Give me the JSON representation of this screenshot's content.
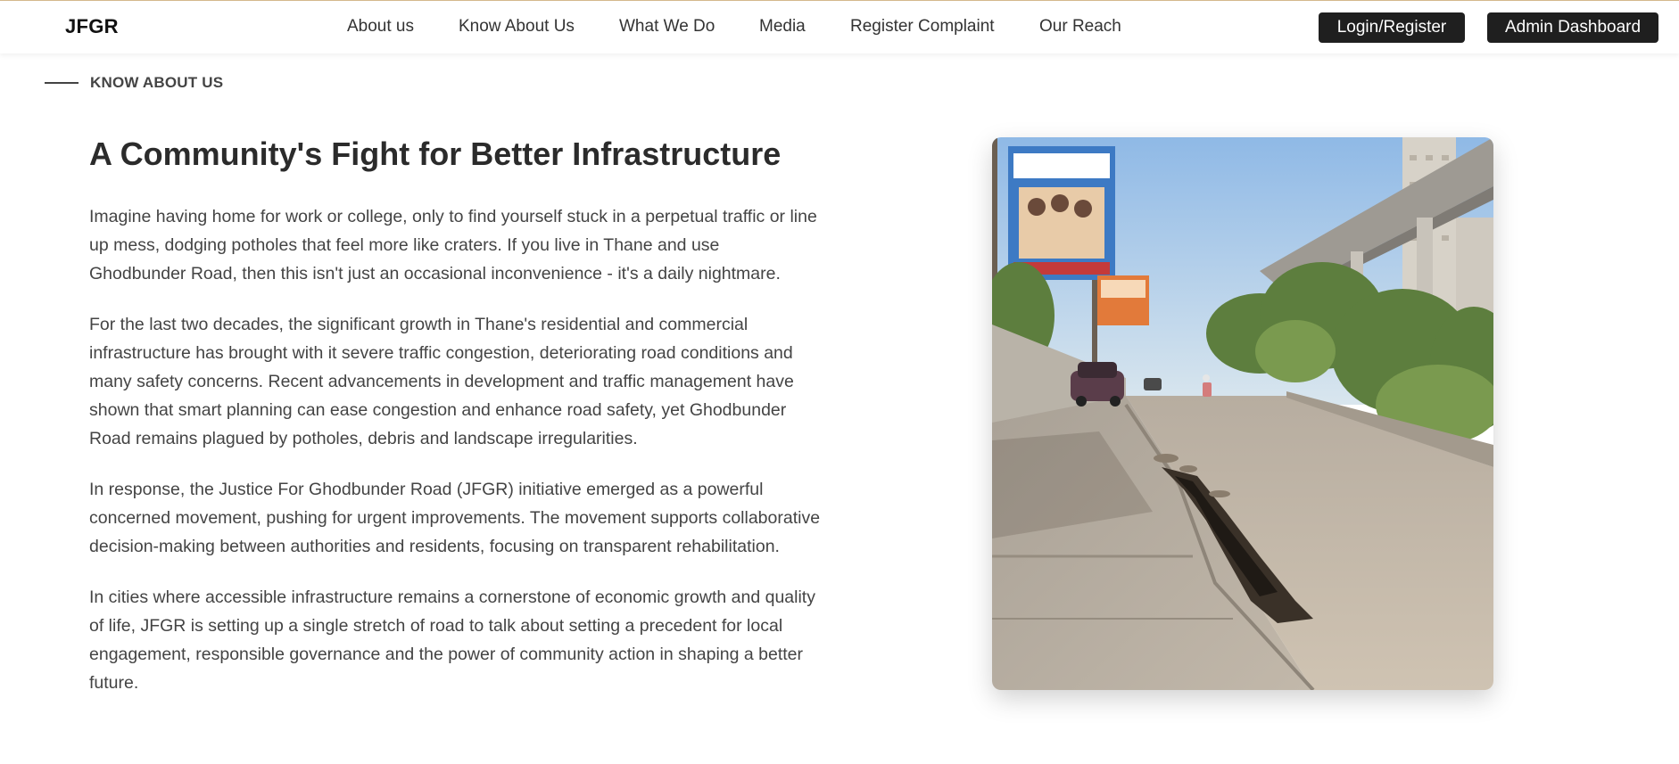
{
  "header": {
    "brand": "JFGR",
    "nav": [
      {
        "label": "About us",
        "name": "nav-about-us"
      },
      {
        "label": "Know About Us",
        "name": "nav-know-about-us"
      },
      {
        "label": "What We Do",
        "name": "nav-what-we-do"
      },
      {
        "label": "Media",
        "name": "nav-media"
      },
      {
        "label": "Register Complaint",
        "name": "nav-register-complaint"
      },
      {
        "label": "Our Reach",
        "name": "nav-our-reach"
      }
    ],
    "login_label": "Login/Register",
    "admin_label": "Admin Dashboard"
  },
  "section": {
    "label": "KNOW ABOUT US"
  },
  "content": {
    "title": "A Community's Fight for Better Infrastructure",
    "paragraphs": [
      "Imagine having home for work or college, only to find yourself stuck in a perpetual traffic or line up mess, dodging potholes that feel more like craters. If you live in Thane and use Ghodbunder Road, then this isn't just an occasional inconvenience - it's a daily nightmare.",
      "For the last two decades, the significant growth in Thane's residential and commercial infrastructure has brought with it severe traffic congestion, deteriorating road conditions and many safety concerns. Recent advancements in development and traffic management have shown that smart planning can ease congestion and enhance road safety, yet Ghodbunder Road remains plagued by potholes, debris and landscape irregularities.",
      "In response, the Justice For Ghodbunder Road (JFGR) initiative emerged as a powerful concerned movement, pushing for urgent improvements. The movement supports collaborative decision-making between authorities and residents, focusing on transparent rehabilitation.",
      "In cities where accessible infrastructure remains a cornerstone of economic growth and quality of life, JFGR is setting up a single stretch of road to talk about setting a precedent for local engagement, responsible governance and the power of community action in shaping a better future."
    ]
  },
  "colors": {
    "button_bg": "#1f1f1f",
    "button_text": "#ffffff",
    "header_top_border": "#d4b98c",
    "text": "#444444",
    "heading": "#2b2b2b"
  }
}
